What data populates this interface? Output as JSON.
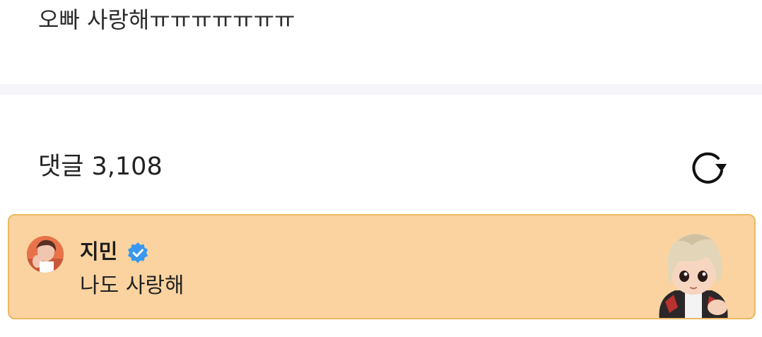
{
  "post": {
    "text": "오빠 사랑해ㅠㅠㅠㅠㅠㅠㅠ"
  },
  "comments": {
    "header": "댓글 3,108",
    "refresh_icon": "refresh-icon"
  },
  "highlighted_comment": {
    "author": "지민",
    "verified": true,
    "verified_icon": "verified-badge-icon",
    "text": "나도 사랑해",
    "avatar_icon": "avatar",
    "sticker_icon": "character-sticker"
  },
  "colors": {
    "card_background": "#fad3a0",
    "card_border": "#eab862",
    "verified_blue": "#3897f0",
    "divider": "#f5f5fa"
  }
}
